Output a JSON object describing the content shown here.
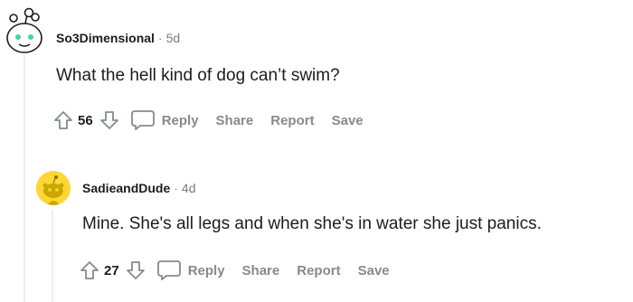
{
  "comments": [
    {
      "username": "So3Dimensional",
      "separator": "·",
      "age": "5d",
      "text": "What the hell kind of dog can’t swim?",
      "score": "56",
      "actions": {
        "reply": "Reply",
        "share": "Share",
        "report": "Report",
        "save": "Save"
      },
      "avatar_icon": "snoo-avatar-icon"
    },
    {
      "username": "SadieandDude",
      "separator": "·",
      "age": "4d",
      "text": "Mine. She's all legs and when she's in water she just panics.",
      "score": "27",
      "actions": {
        "reply": "Reply",
        "share": "Share",
        "report": "Report",
        "save": "Save"
      },
      "avatar_icon": "snoo-avatar-icon"
    }
  ],
  "colors": {
    "meta_gray": "#7c7c7c",
    "action_gray": "#878a8c",
    "thread_line": "#edeff1",
    "avatar1_accent": "#3fd5a6",
    "avatar2_bg": "#ffd635"
  }
}
